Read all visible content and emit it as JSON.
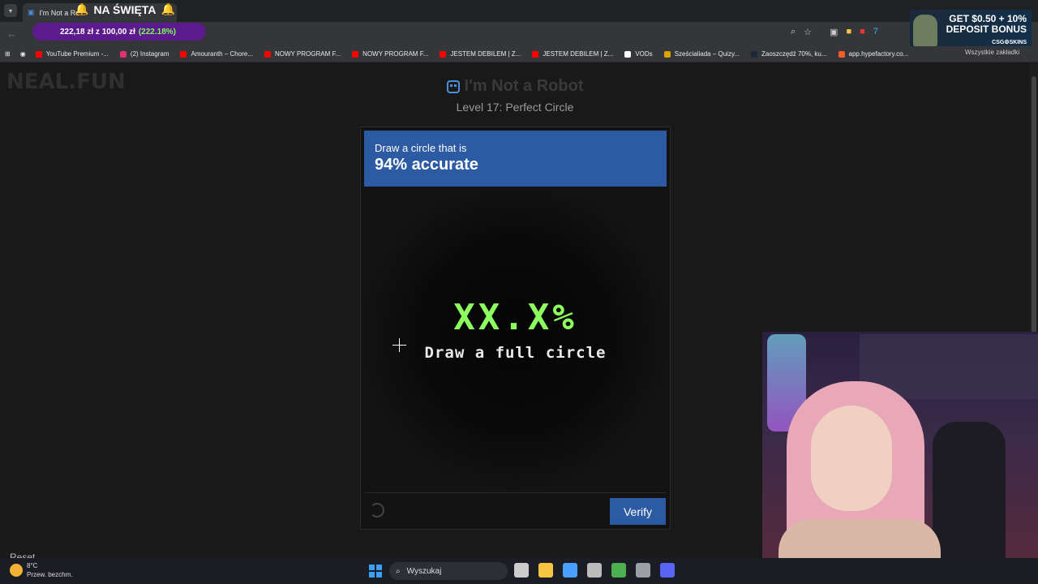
{
  "browser": {
    "tab_title": "I'm Not a Ro",
    "overlay_title": "NA ŚWIĘTA",
    "url_pill": {
      "amount": "222,18 zł z 100,00 zł",
      "percent": "(222.18%)"
    },
    "bookmarks": [
      {
        "label": "YouTube Premium -...",
        "color": "#ff0000"
      },
      {
        "label": "(2) Instagram",
        "color": "#e1306c"
      },
      {
        "label": "Amouranth – Chore...",
        "color": "#ff0000"
      },
      {
        "label": "NOWY PROGRAM F...",
        "color": "#ff0000"
      },
      {
        "label": "NOWY PROGRAM F...",
        "color": "#ff0000"
      },
      {
        "label": "JESTEM DEBILEM | Z...",
        "color": "#ff0000"
      },
      {
        "label": "JESTEM DEBILEM | Z...",
        "color": "#ff0000"
      },
      {
        "label": "VODs",
        "color": "#ffffff"
      },
      {
        "label": "Sześcialiada – Quizy...",
        "color": "#d9a400"
      },
      {
        "label": "Zaoszczędź 70%, ku...",
        "color": "#1b2838"
      },
      {
        "label": "app.hypefactory.co...",
        "color": "#ff5a2a"
      }
    ],
    "all_bookmarks": "Wszystkie zakładki"
  },
  "ad": {
    "line1": "GET $0.50 + 10%",
    "line2": "DEPOSIT BONUS",
    "brand": "CSG⚙SKINS"
  },
  "site": {
    "logo": "NEAL.FUN",
    "title": "I'm Not a Robot",
    "level": "Level 17: Perfect Circle"
  },
  "challenge": {
    "prompt": "Draw a circle that is",
    "target": "94% accurate",
    "score": "XX.X%",
    "instruction": "Draw a full circle",
    "verify_label": "Verify",
    "reset_label": "Reset"
  },
  "taskbar": {
    "temp": "8°C",
    "weather": "Przew. bezchm.",
    "search_placeholder": "Wyszukaj",
    "app_icons": [
      "#cccccc",
      "#f5c542",
      "#4a9eff",
      "#bbbbbb",
      "#4caf50",
      "#9aa0a6",
      "#5865f2"
    ]
  }
}
